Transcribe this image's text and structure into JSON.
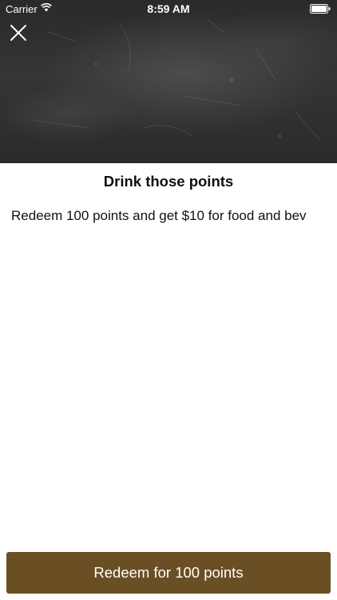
{
  "status_bar": {
    "carrier": "Carrier",
    "time": "8:59 AM",
    "wifi_icon": "wifi-icon",
    "battery_icon": "battery-icon"
  },
  "header": {
    "image": "chalkboard-image",
    "close_icon": "close-icon"
  },
  "reward": {
    "title": "Drink those points",
    "description": "Redeem 100 points and get $10 for food and bev"
  },
  "actions": {
    "redeem_label": "Redeem for 100 points"
  },
  "colors": {
    "button": "#6b4f24",
    "text": "#111111",
    "background": "#ffffff"
  }
}
